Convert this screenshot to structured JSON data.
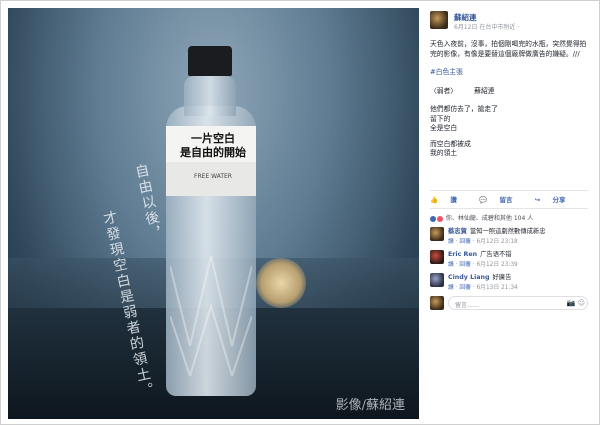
{
  "photo": {
    "bottle_label_main": "一片空白\n是自由的開始",
    "bottle_label_sub": "FREE WATER",
    "overlay_text_1": "自由以後，",
    "overlay_text_2": "才發現空白是弱者的領土。",
    "credit": "影像/蘇紹連"
  },
  "post": {
    "author": "蘇紹連",
    "meta": "6月12日 在台中市附近 ·",
    "paragraph_1": "天色入夜前，沒事，拍個剛喝完的水瓶，突然覺得拍完的影像，有像是要替這個廠牌做廣告的嫌疑。///",
    "hashtag": "#白色主張",
    "title_line": "〈弱者〉　　　蘇紹連",
    "poem_lines": [
      "他們都仿去了，搶走了",
      "留下的",
      "全是空白",
      "而空白都被成",
      "我的領土"
    ]
  },
  "actions": {
    "like": "讚",
    "comment": "留言",
    "share": "分享"
  },
  "likes": {
    "text": "你、林仙龍、成碧和其他 104 人"
  },
  "comments": [
    {
      "name": "蔡志賀",
      "text": "當知一照這劇然數傳成新忠",
      "meta_like": "讚",
      "meta_reply": "回覆",
      "time": "6月12日 23:18"
    },
    {
      "name": "Eric Ren",
      "text": "广告语不错",
      "meta_like": "讚",
      "meta_reply": "回覆",
      "time": "6月12日 23:39"
    },
    {
      "name": "Cindy Liang",
      "text": "好廣告",
      "meta_like": "讚",
      "meta_reply": "回覆",
      "time": "6月13日 21:34"
    }
  ],
  "reply": {
    "placeholder": "留言……"
  },
  "colors": {
    "link": "#365899",
    "accent": "#4267b2"
  }
}
